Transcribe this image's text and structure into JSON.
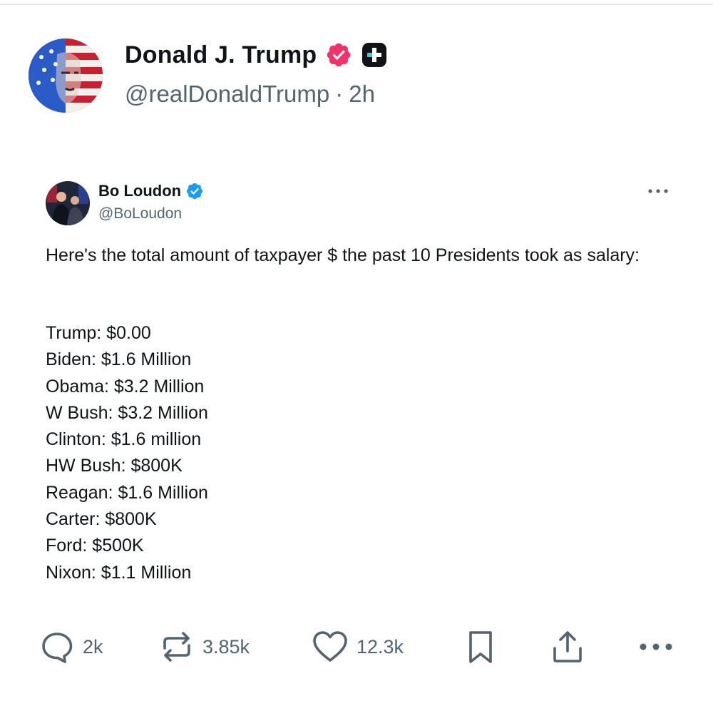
{
  "post": {
    "author_name": "Donald J. Trump",
    "author_handle": "@realDonaldTrump",
    "separator": "·",
    "time": "2h"
  },
  "quoted_post": {
    "author_name": "Bo Loudon",
    "author_handle": "@BoLoudon",
    "intro": "Here's the total amount of taxpayer $ the past 10 Presidents took as salary:",
    "lines": [
      "Trump: $0.00",
      "Biden: $1.6 Million",
      "Obama: $3.2 Million",
      "W Bush: $3.2 Million",
      "Clinton: $1.6 million",
      "HW Bush: $800K",
      "Reagan: $1.6 Million",
      "Carter: $800K",
      "Ford: $500K",
      "Nixon: $1.1 Million"
    ]
  },
  "actions": {
    "replies": "2k",
    "reposts": "3.85k",
    "likes": "12.3k"
  },
  "icons": {
    "verified_main": "verified-badge-pink-icon",
    "plus": "plus-badge-icon",
    "verified_quote": "verified-badge-blue-icon",
    "more": "more-horizontal-icon",
    "reply": "reply-icon",
    "repost": "repost-icon",
    "like": "heart-icon",
    "bookmark": "bookmark-icon",
    "share": "share-icon"
  },
  "colors": {
    "verified_pink": "#f0346a",
    "verified_blue": "#1d9bf0",
    "secondary_text": "#536471",
    "primary_text": "#0f1419"
  }
}
